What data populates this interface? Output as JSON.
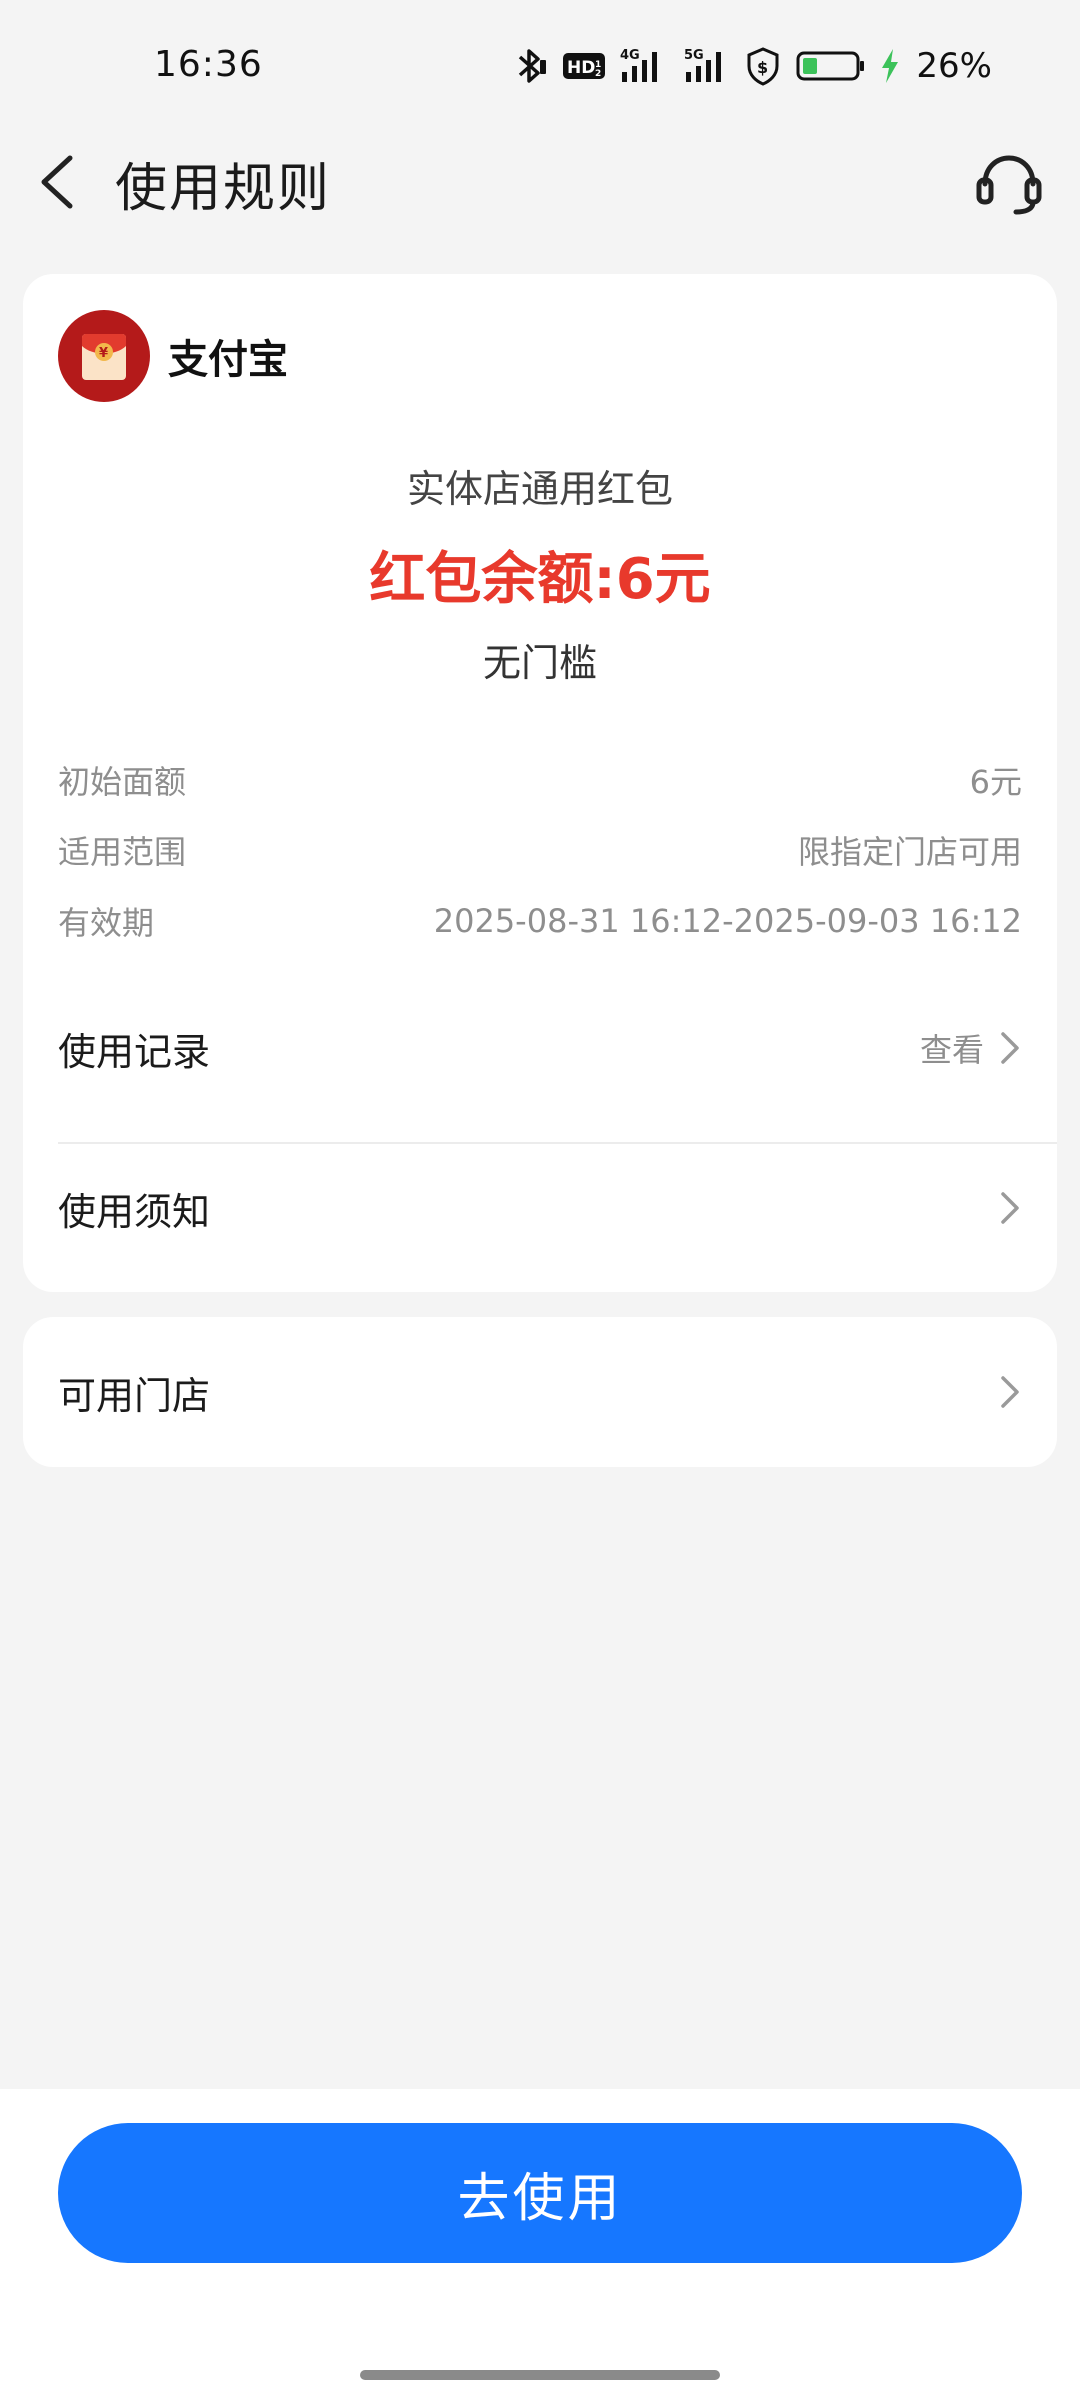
{
  "status_bar": {
    "time": "16:36",
    "battery": "26%",
    "icons": [
      "bluetooth-icon",
      "hd-icon",
      "signal-4g-icon",
      "signal-5g-icon",
      "shield-dollar-icon",
      "battery-icon",
      "charging-icon"
    ]
  },
  "header": {
    "title": "使用规则",
    "back_icon": "chevron-left-icon",
    "service_icon": "headset-icon"
  },
  "brand": {
    "name": "支付宝",
    "logo_icon": "red-envelope-icon",
    "logo_symbol": "¥"
  },
  "coupon": {
    "name": "实体店通用红包",
    "balance": "红包余额:6元",
    "threshold": "无门槛"
  },
  "details": [
    {
      "label": "初始面额",
      "value": "6元"
    },
    {
      "label": "适用范围",
      "value": "限指定门店可用"
    },
    {
      "label": "有效期",
      "value": "2025-08-31 16:12-2025-09-03 16:12"
    }
  ],
  "actions": {
    "usage_record": {
      "label": "使用记录",
      "hint": "查看"
    },
    "usage_notice": {
      "label": "使用须知"
    },
    "available_stores": {
      "label": "可用门店"
    }
  },
  "footer": {
    "use_button": "去使用"
  },
  "colors": {
    "accent_blue": "#1677ff",
    "balance_red": "#e8392c",
    "background": "#f4f4f4",
    "card": "#ffffff"
  }
}
